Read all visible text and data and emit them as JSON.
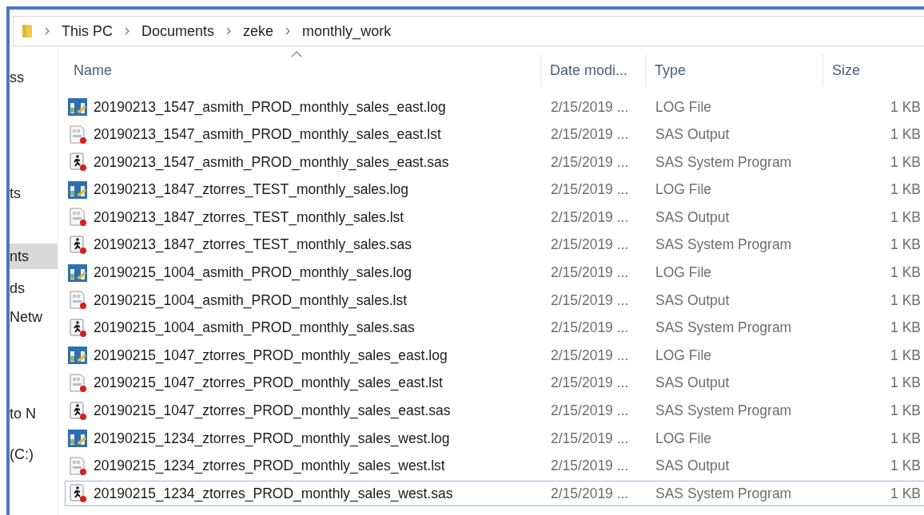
{
  "breadcrumb": [
    "This PC",
    "Documents",
    "zeke",
    "monthly_work"
  ],
  "nav": [
    {
      "label": "ss",
      "selected": false
    },
    {
      "label": "ts",
      "selected": false
    },
    {
      "label": "nts",
      "selected": true
    },
    {
      "label": "ds",
      "selected": false
    },
    {
      "label": "Netw",
      "selected": false
    },
    {
      "label": "to N",
      "selected": false
    },
    {
      "label": "(C:)",
      "selected": false
    }
  ],
  "columns": [
    "Name",
    "Date modi...",
    "Type",
    "Size"
  ],
  "files": [
    {
      "kind": "log",
      "name": "20190213_1547_asmith_PROD_monthly_sales_east.log",
      "date": "2/15/2019 ...",
      "type": "LOG File",
      "size": "1 KB",
      "focused": false
    },
    {
      "kind": "lst",
      "name": "20190213_1547_asmith_PROD_monthly_sales_east.lst",
      "date": "2/15/2019 ...",
      "type": "SAS Output",
      "size": "1 KB",
      "focused": false
    },
    {
      "kind": "sas",
      "name": "20190213_1547_asmith_PROD_monthly_sales_east.sas",
      "date": "2/15/2019 ...",
      "type": "SAS System Program",
      "size": "1 KB",
      "focused": false
    },
    {
      "kind": "log",
      "name": "20190213_1847_ztorres_TEST_monthly_sales.log",
      "date": "2/15/2019 ...",
      "type": "LOG File",
      "size": "1 KB",
      "focused": false
    },
    {
      "kind": "lst",
      "name": "20190213_1847_ztorres_TEST_monthly_sales.lst",
      "date": "2/15/2019 ...",
      "type": "SAS Output",
      "size": "1 KB",
      "focused": false
    },
    {
      "kind": "sas",
      "name": "20190213_1847_ztorres_TEST_monthly_sales.sas",
      "date": "2/15/2019 ...",
      "type": "SAS System Program",
      "size": "1 KB",
      "focused": false
    },
    {
      "kind": "log",
      "name": "20190215_1004_asmith_PROD_monthly_sales.log",
      "date": "2/15/2019 ...",
      "type": "LOG File",
      "size": "1 KB",
      "focused": false
    },
    {
      "kind": "lst",
      "name": "20190215_1004_asmith_PROD_monthly_sales.lst",
      "date": "2/15/2019 ...",
      "type": "SAS Output",
      "size": "1 KB",
      "focused": false
    },
    {
      "kind": "sas",
      "name": "20190215_1004_asmith_PROD_monthly_sales.sas",
      "date": "2/15/2019 ...",
      "type": "SAS System Program",
      "size": "1 KB",
      "focused": false
    },
    {
      "kind": "log",
      "name": "20190215_1047_ztorres_PROD_monthly_sales_east.log",
      "date": "2/15/2019 ...",
      "type": "LOG File",
      "size": "1 KB",
      "focused": false
    },
    {
      "kind": "lst",
      "name": "20190215_1047_ztorres_PROD_monthly_sales_east.lst",
      "date": "2/15/2019 ...",
      "type": "SAS Output",
      "size": "1 KB",
      "focused": false
    },
    {
      "kind": "sas",
      "name": "20190215_1047_ztorres_PROD_monthly_sales_east.sas",
      "date": "2/15/2019 ...",
      "type": "SAS System Program",
      "size": "1 KB",
      "focused": false
    },
    {
      "kind": "log",
      "name": "20190215_1234_ztorres_PROD_monthly_sales_west.log",
      "date": "2/15/2019 ...",
      "type": "LOG File",
      "size": "1 KB",
      "focused": false
    },
    {
      "kind": "lst",
      "name": "20190215_1234_ztorres_PROD_monthly_sales_west.lst",
      "date": "2/15/2019 ...",
      "type": "SAS Output",
      "size": "1 KB",
      "focused": false
    },
    {
      "kind": "sas",
      "name": "20190215_1234_ztorres_PROD_monthly_sales_west.sas",
      "date": "2/15/2019 ...",
      "type": "SAS System Program",
      "size": "1 KB",
      "focused": true
    }
  ]
}
